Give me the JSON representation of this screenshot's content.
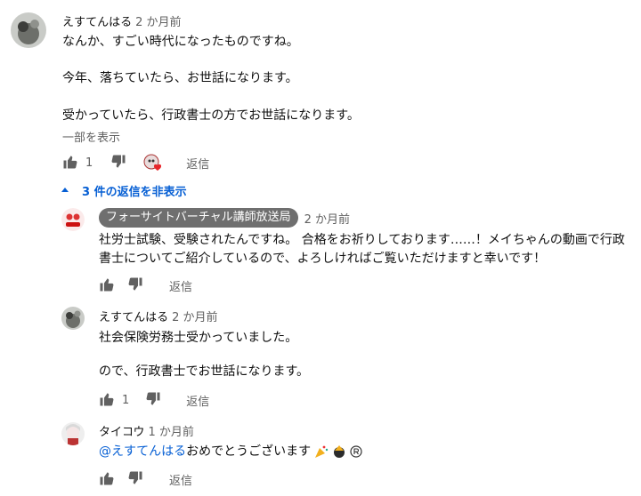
{
  "comment": {
    "author": "えすてんはる",
    "time": "2 か月前",
    "lines": [
      "なんか、すごい時代になったものですね。",
      "今年、落ちていたら、お世話になります。",
      "受かっていたら、行政書士の方でお世話になります。"
    ],
    "read_more": "一部を表示",
    "likes": "1",
    "reply_label": "返信"
  },
  "replies_toggle": "3 件の返信を非表示",
  "replies": [
    {
      "author": "フォーサイトバーチャル講師放送局",
      "time": "2 か月前",
      "lines": [
        "社労士試験、受験されたんですね。 合格をお祈りしております……！メイちゃんの動画で行政",
        "書士についてご紹介しているので、よろしければご覧いただけますと幸いです！"
      ],
      "reply_label": "返信"
    },
    {
      "author": "えすてんはる",
      "time": "2 か月前",
      "lines": [
        "社会保険労務士受かっていました。",
        "ので、行政書士でお世話になります。"
      ],
      "likes": "1",
      "reply_label": "返信"
    },
    {
      "author": "タイコウ",
      "time": "1 か月前",
      "mention": "@えすてんはる",
      "text": " おめでとうございます",
      "reply_label": "返信"
    }
  ],
  "colors": {
    "link_blue": "#065fd4",
    "muted_gray": "#606060",
    "heart_red": "#e8252a"
  }
}
